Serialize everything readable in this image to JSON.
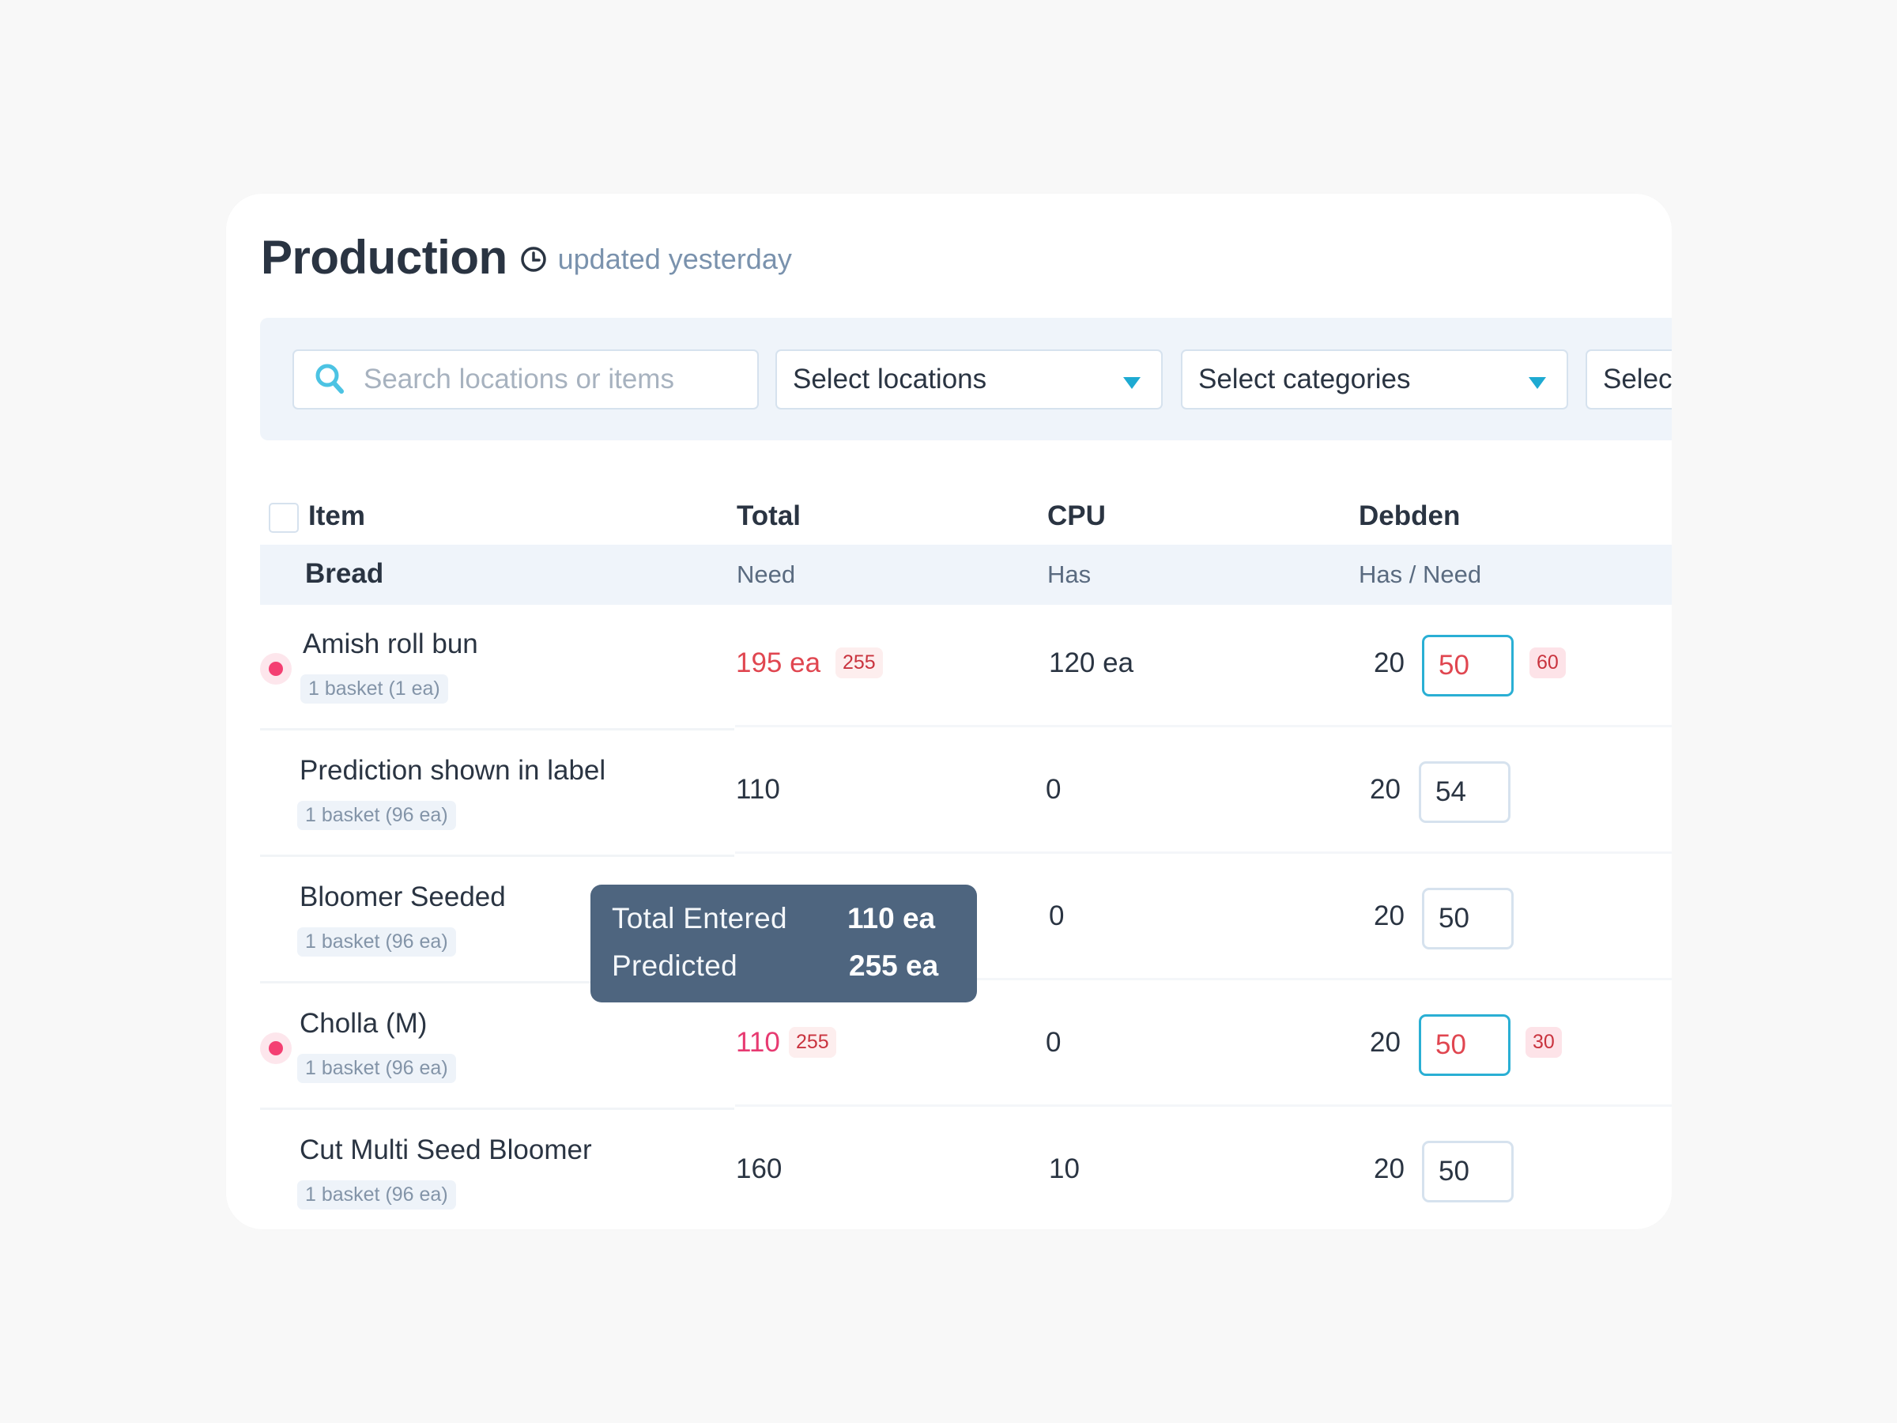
{
  "header": {
    "title": "Production",
    "updated_icon": "clock-icon",
    "updated_text": "updated yesterday"
  },
  "filters": {
    "search": {
      "icon": "search-icon",
      "placeholder": "Search locations or items",
      "value": ""
    },
    "locations": {
      "label": "Select locations",
      "icon": "caret-down-icon"
    },
    "categories": {
      "label": "Select categories",
      "icon": "caret-down-icon"
    },
    "fourth": {
      "label": "Select"
    }
  },
  "table": {
    "columns": [
      "Item",
      "Total",
      "CPU",
      "Debden"
    ],
    "category": {
      "name": "Bread",
      "subheaders": [
        "Need",
        "Has",
        "Has / Need"
      ]
    },
    "rows": [
      {
        "flag": true,
        "name": "Amish roll bun",
        "unit": "1 basket (1 ea)",
        "total": "195 ea",
        "total_style": "red",
        "predicted_badge": "255",
        "cpu_has": "120 ea",
        "debden_has": "20",
        "debden_need": "50",
        "debden_need_active": true,
        "debden_badge": "60"
      },
      {
        "flag": false,
        "name": "Prediction shown in label",
        "unit": "1 basket (96 ea)",
        "total": "110",
        "total_style": "normal",
        "predicted_badge": null,
        "cpu_has": "0",
        "debden_has": "20",
        "debden_need": "54",
        "debden_need_active": false,
        "debden_badge": null
      },
      {
        "flag": false,
        "name": "Bloomer Seeded",
        "unit": "1 basket (96 ea)",
        "total": "",
        "total_style": "normal",
        "predicted_badge": null,
        "cpu_has": "0",
        "debden_has": "20",
        "debden_need": "50",
        "debden_need_active": false,
        "debden_badge": null
      },
      {
        "flag": true,
        "name": "Cholla (M)",
        "unit": "1 basket (96 ea)",
        "total": "110",
        "total_style": "pink",
        "predicted_badge": "255",
        "cpu_has": "0",
        "debden_has": "20",
        "debden_need": "50",
        "debden_need_active": true,
        "debden_badge": "30"
      },
      {
        "flag": false,
        "name": "Cut Multi Seed Bloomer",
        "unit": "1 basket (96 ea)",
        "total": "160",
        "total_style": "normal",
        "predicted_badge": null,
        "cpu_has": "10",
        "debden_has": "20",
        "debden_need": "50",
        "debden_need_active": false,
        "debden_badge": null
      }
    ]
  },
  "tooltip": {
    "rows": [
      {
        "label": "Total Entered",
        "value": "110 ea"
      },
      {
        "label": "Predicted",
        "value": "255 ea"
      }
    ]
  },
  "colors": {
    "accent": "#1eaad2",
    "alert": "#e04650",
    "flag_dot": "#f43f72",
    "tooltip_bg": "#4e657f",
    "band_bg": "#eff4fa"
  }
}
